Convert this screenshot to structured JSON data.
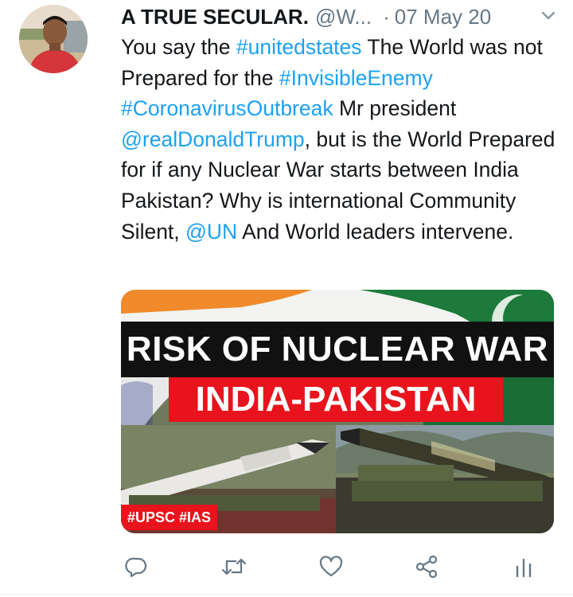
{
  "tweet": {
    "author_name": "A TRUE SECULAR.",
    "author_handle": "@W...",
    "separator": "·",
    "date": "07 May 20",
    "text_parts": {
      "p1": "You say the ",
      "h1": "#unitedstates",
      "p2": " The World was not Prepared for the ",
      "h2": "#InvisibleEnemy",
      "p3": " ",
      "h3": "#CoronavirusOutbreak",
      "p4": " Mr president ",
      "m1": "@realDonaldTrump",
      "p5": ", but is the World Prepared for if any Nuclear War starts between India Pakistan? Why is international Community Silent, ",
      "m2": "@UN",
      "p6": " And World leaders intervene."
    },
    "media": {
      "headline": "RISK OF NUCLEAR WAR",
      "subheadline": "INDIA-PAKISTAN",
      "tag": "#UPSC #IAS"
    }
  },
  "colors": {
    "link": "#1da1f2",
    "text": "#14171a",
    "secondary": "#657786",
    "banner_red": "#e8131c"
  },
  "icons": [
    "caret-down-icon",
    "reply-icon",
    "retweet-icon",
    "like-icon",
    "share-icon",
    "analytics-icon"
  ]
}
